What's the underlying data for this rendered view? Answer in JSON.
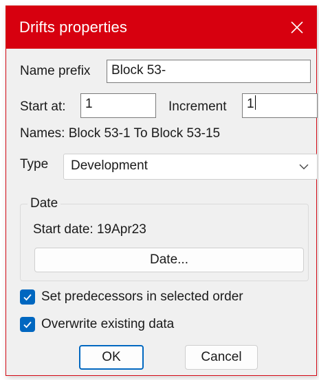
{
  "window": {
    "title": "Drifts properties",
    "close_icon": "close-icon"
  },
  "name_prefix": {
    "label": "Name prefix",
    "value": "Block 53-"
  },
  "start_at": {
    "label": "Start at:",
    "value": "1"
  },
  "increment": {
    "label": "Increment",
    "value": "1"
  },
  "names_summary": "Names: Block 53-1 To Block 53-15",
  "type": {
    "label": "Type",
    "selected": "Development"
  },
  "date_group": {
    "legend": "Date",
    "start_date": "Start date: 19Apr23",
    "button_label": "Date..."
  },
  "options": [
    {
      "label": "Set predecessors in selected order",
      "checked": true
    },
    {
      "label": "Overwrite existing data",
      "checked": true
    }
  ],
  "buttons": {
    "ok_label": "OK",
    "cancel_label": "Cancel"
  },
  "colors": {
    "titlebar": "#d7000f",
    "accent": "#0067c0",
    "dialog_bg": "#f0f0f0"
  }
}
